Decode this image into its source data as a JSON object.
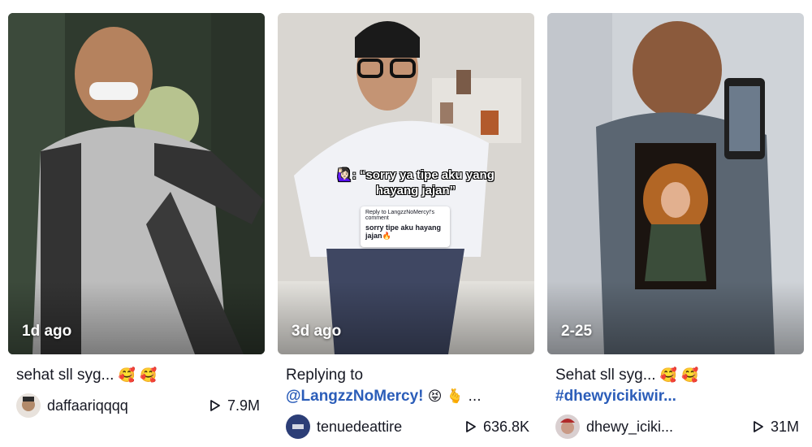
{
  "videos": [
    {
      "date": "1d ago",
      "caption": "sehat sll syg...",
      "caption_emoji": "🥰 🥰",
      "username": "daffaariqqqq",
      "views": "7.9M"
    },
    {
      "date": "3d ago",
      "caption_line1": "Replying to",
      "caption_tag": "@LangzzNoMercy!",
      "caption_emoji": "😝 🫰 ...",
      "overlay_text": "🙋🏻‍♀️: “sorry ya tipe aku yang hayang jajan”",
      "reply_header": "Reply to LangzzNoMercy!'s comment",
      "reply_text": "sorry tipe aku hayang jajan🔥",
      "username": "tenuedeattire",
      "views": "636.8K"
    },
    {
      "date": "2-25",
      "caption_line1": "Sehat sll syg...",
      "caption_line1_emoji": "🥰 🥰",
      "caption_tag": "#dhewyicikiwir...",
      "username": "dhewy_iciki...",
      "views": "31M"
    }
  ]
}
